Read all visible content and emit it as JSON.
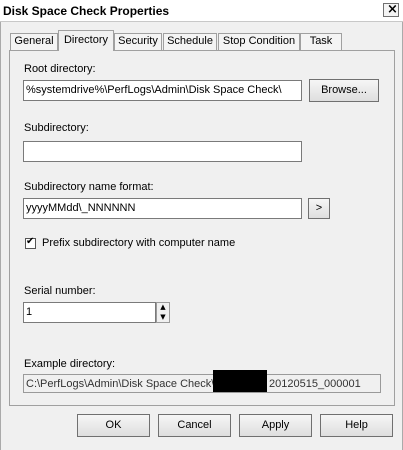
{
  "window": {
    "title": "Disk Space Check Properties",
    "close_symbol": "×"
  },
  "tabs": [
    {
      "label": "General"
    },
    {
      "label": "Directory"
    },
    {
      "label": "Security"
    },
    {
      "label": "Schedule"
    },
    {
      "label": "Stop Condition"
    },
    {
      "label": "Task"
    }
  ],
  "active_tab": "Directory",
  "directory": {
    "root_label": "Root directory:",
    "root_value": "%systemdrive%\\PerfLogs\\Admin\\Disk Space Check\\",
    "browse_label": "Browse...",
    "subdir_label": "Subdirectory:",
    "subdir_value": "",
    "format_label": "Subdirectory name format:",
    "format_value": "yyyyMMdd\\_NNNNNN",
    "format_button": ">",
    "prefix_label": "Prefix subdirectory with computer name",
    "prefix_checked": true,
    "serial_label": "Serial number:",
    "serial_value": "1",
    "example_label": "Example directory:",
    "example_prefix": "C:\\PerfLogs\\Admin\\Disk Space Check\\",
    "example_suffix": "20120515_000001"
  },
  "buttons": {
    "ok": "OK",
    "cancel": "Cancel",
    "apply": "Apply",
    "help": "Help"
  }
}
